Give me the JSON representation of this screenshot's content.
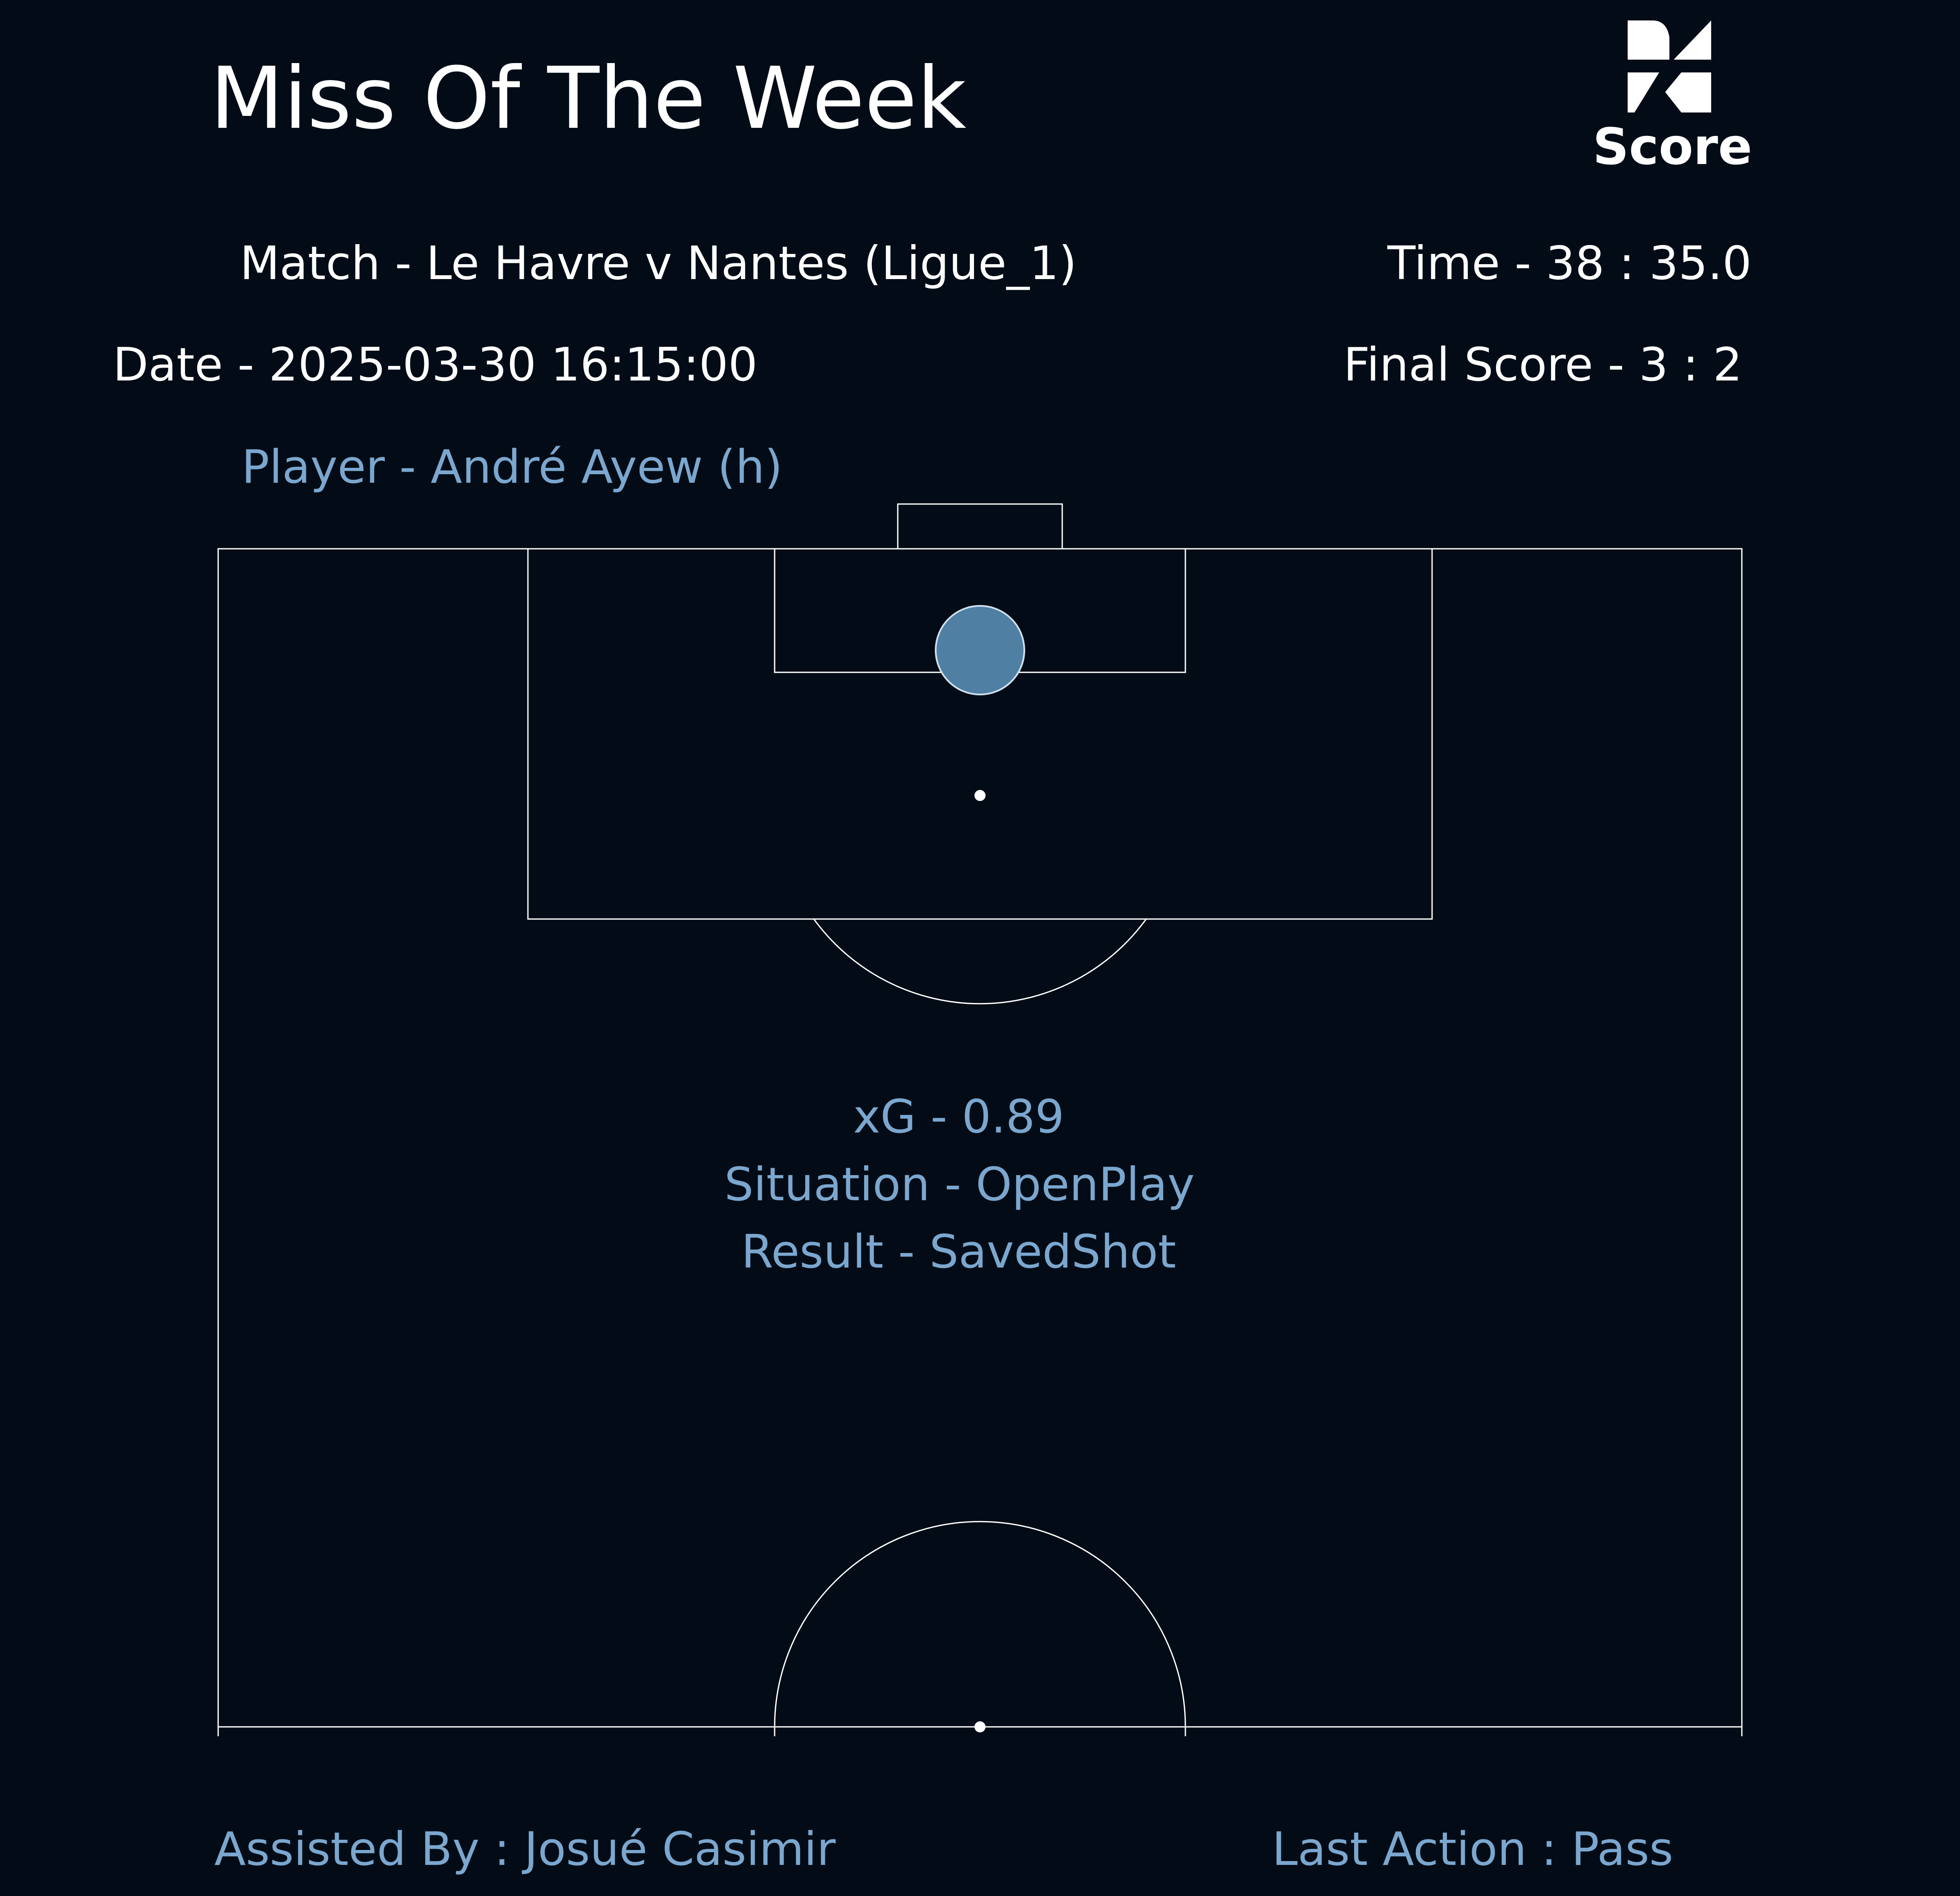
{
  "header": {
    "title": "Miss Of The Week",
    "logo_text": "Score"
  },
  "match_info": {
    "match": "Match - Le Havre v Nantes (Ligue_1)",
    "time": "Time - 38 : 35.0",
    "date": "Date - 2025-03-30 16:15:00",
    "final_score": "Final Score - 3 : 2",
    "player": "Player - André Ayew (h)"
  },
  "shot": {
    "xg": "xG - 0.89",
    "situation": "Situation - OpenPlay",
    "result": "Result - SavedShot"
  },
  "footer": {
    "assisted_by": "Assisted By : Josué Casimir",
    "last_action": "Last Action : Pass"
  },
  "colors": {
    "background": "#030c16",
    "lines": "#ffffff",
    "accent": "#7ba7cf",
    "shot_marker": "#4f7fa3"
  }
}
